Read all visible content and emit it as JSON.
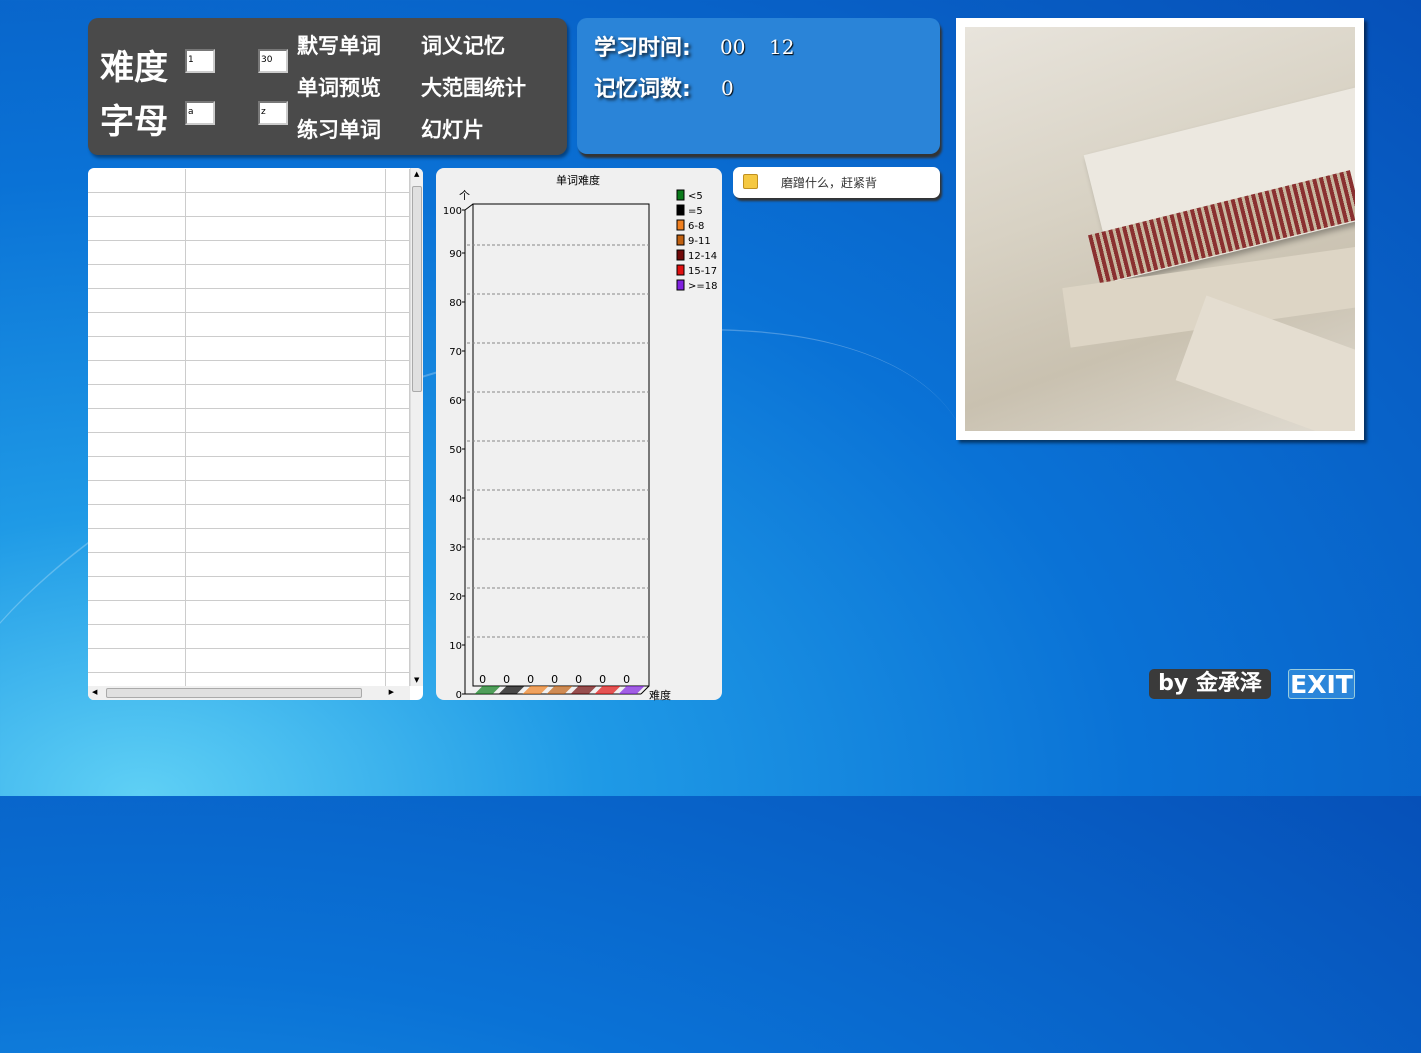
{
  "controls": {
    "difficulty_label": "难度",
    "letter_label": "字母",
    "difficulty_min": "1",
    "difficulty_max": "30",
    "letter_min": "a",
    "letter_max": "z"
  },
  "menu": [
    "默写单词",
    "词义记忆",
    "单词预览",
    "大范围统计",
    "练习单词",
    "幻灯片"
  ],
  "stats": {
    "time_label": "学习时间:",
    "time_hours": "00",
    "time_minutes": "12",
    "count_label": "记忆词数:",
    "count_value": "0"
  },
  "notice": {
    "text": "磨蹭什么，赶紧背",
    "icon": "notepad-icon"
  },
  "footer": {
    "byline": "by 金承泽",
    "exit": "EXIT"
  },
  "chart_data": {
    "type": "bar",
    "title": "单词难度",
    "ylabel": "个",
    "xlabel": "难度",
    "ylim": [
      0,
      100
    ],
    "yticks": [
      "0",
      "10",
      "20",
      "30",
      "40",
      "50",
      "60",
      "70",
      "80",
      "90",
      "100"
    ],
    "grid": true,
    "legend": "right",
    "series": [
      {
        "name": "<5",
        "value": 0,
        "color": "#0a7a1a"
      },
      {
        "name": "=5",
        "value": 0,
        "color": "#000000"
      },
      {
        "name": "6-8",
        "value": 0,
        "color": "#f08020"
      },
      {
        "name": "9-11",
        "value": 0,
        "color": "#c06010"
      },
      {
        "name": "12-14",
        "value": 0,
        "color": "#700808"
      },
      {
        "name": "15-17",
        "value": 0,
        "color": "#e01010"
      },
      {
        "name": ">=18",
        "value": 0,
        "color": "#8020e0"
      }
    ]
  }
}
